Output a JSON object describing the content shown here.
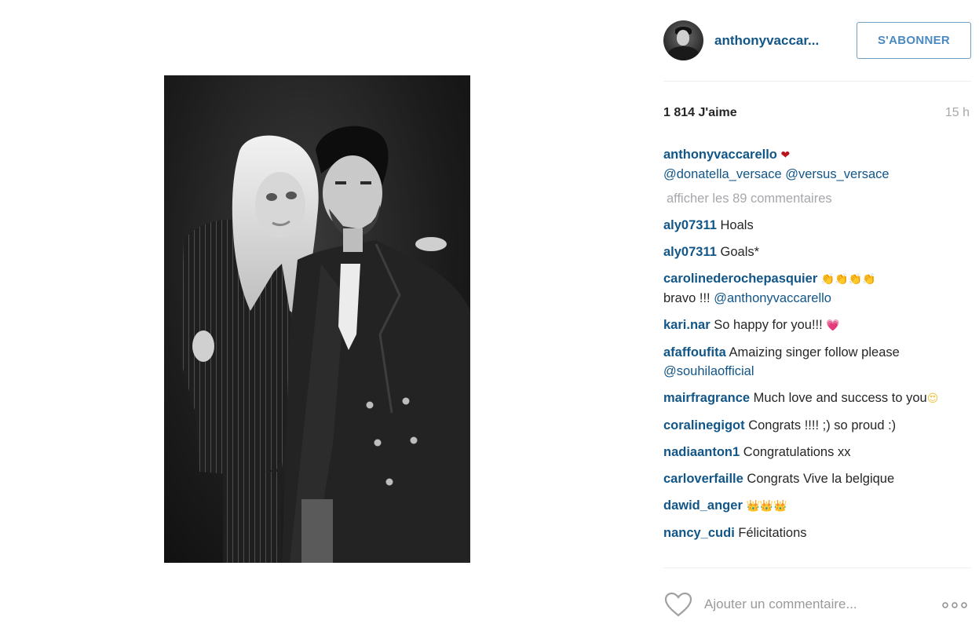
{
  "post": {
    "photo_alt": "",
    "author": {
      "username": "anthonyvaccar...",
      "avatar_icon": "profile-avatar"
    },
    "follow_button": "S'ABONNER",
    "likes": "1 814 J'aime",
    "timestamp": "15 h",
    "caption": {
      "user": "anthonyvaccarello",
      "emoji": "❤",
      "mentions": "@donatella_versace @versus_versace"
    },
    "view_all_comments": "afficher les 89 commentaires",
    "comments": [
      {
        "user": "aly07311",
        "text": "Hoals",
        "emoji": "",
        "mention": ""
      },
      {
        "user": "aly07311",
        "text": "Goals*",
        "emoji": "",
        "mention": ""
      },
      {
        "user": "carolinederochepasquier",
        "text": "bravo !!! ",
        "emoji": "👏👏👏👏",
        "mention": "@anthonyvaccarello"
      },
      {
        "user": "kari.nar",
        "text": "So happy for you!!! ",
        "emoji": "💗",
        "mention": ""
      },
      {
        "user": "afaffoufita",
        "text": "Amaizing singer follow please ",
        "emoji": "",
        "mention": "@souhilaofficial"
      },
      {
        "user": "mairfragrance",
        "text": "Much love and success to you",
        "emoji": "😍",
        "mention": ""
      },
      {
        "user": "coralinegigot",
        "text": "Congrats !!!! ;) so proud :)",
        "emoji": "",
        "mention": ""
      },
      {
        "user": "nadiaanton1",
        "text": "Congratulations xx",
        "emoji": "",
        "mention": ""
      },
      {
        "user": "carloverfaille",
        "text": "Congrats Vive la belgique",
        "emoji": "",
        "mention": ""
      },
      {
        "user": "dawid_anger",
        "text": " ",
        "emoji": "👑👑👑",
        "mention": ""
      },
      {
        "user": "nancy_cudi",
        "text": "Félicitations",
        "emoji": "",
        "mention": ""
      }
    ],
    "comment_placeholder": "Ajouter un commentaire...",
    "icons": {
      "like": "heart-outline-icon",
      "more": "more-options-icon"
    },
    "colors": {
      "link_blue": "#125688",
      "button_border": "#70a1c3",
      "muted_gray": "#a5a7aa"
    }
  }
}
